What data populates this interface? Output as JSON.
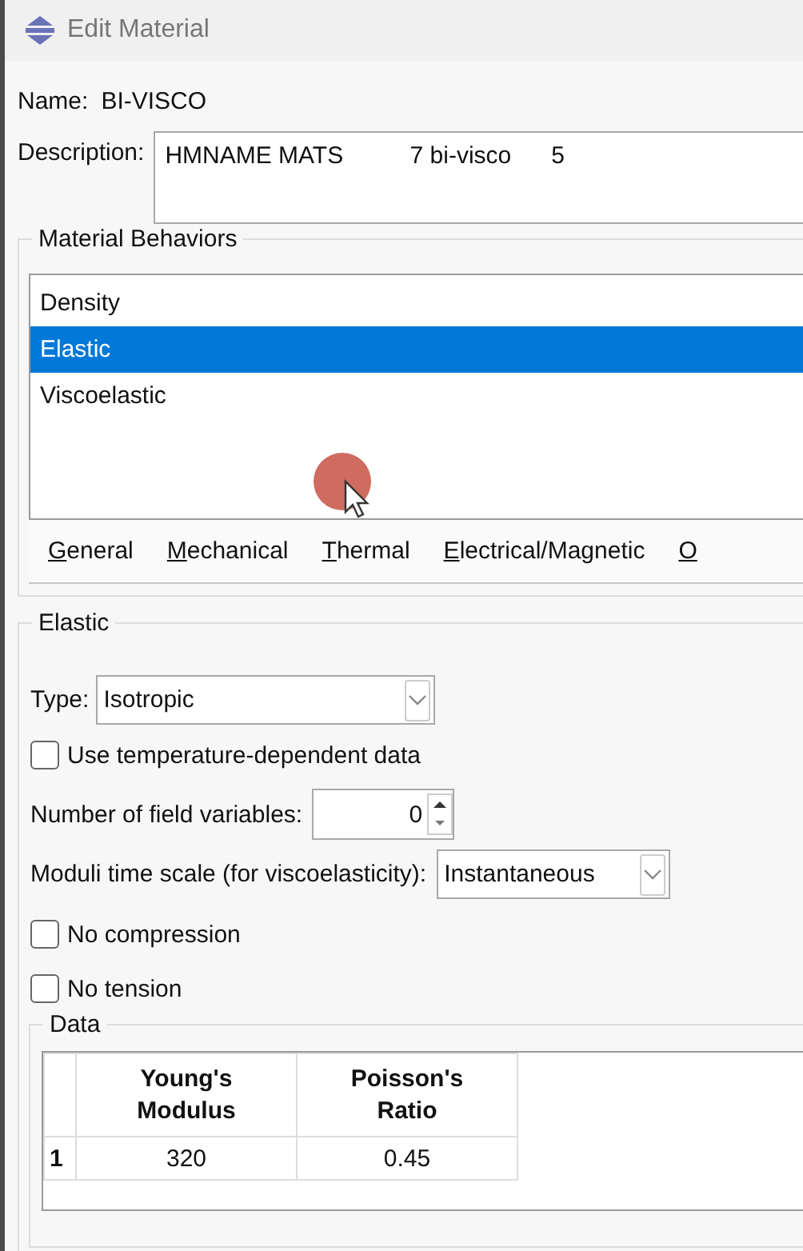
{
  "window": {
    "title": "Edit Material"
  },
  "name": {
    "label": "Name:",
    "value": "BI-VISCO"
  },
  "description": {
    "label": "Description:",
    "value": "HMNAME MATS          7 bi-visco      5"
  },
  "behaviors": {
    "title": "Material Behaviors",
    "items": [
      {
        "label": "Density",
        "selected": false
      },
      {
        "label": "Elastic",
        "selected": true
      },
      {
        "label": "Viscoelastic",
        "selected": false
      }
    ],
    "menu": [
      "General",
      "Mechanical",
      "Thermal",
      "Electrical/Magnetic",
      "O"
    ]
  },
  "elastic": {
    "title": "Elastic",
    "type": {
      "label": "Type:",
      "value": "Isotropic"
    },
    "temperature": {
      "label": "Use temperature-dependent data",
      "checked": false
    },
    "field_variables": {
      "label": "Number of field variables:",
      "value": "0"
    },
    "moduli": {
      "label": "Moduli time scale (for viscoelasticity):",
      "value": "Instantaneous"
    },
    "options": [
      {
        "label": "No compression",
        "checked": false
      },
      {
        "label": "No tension",
        "checked": false
      }
    ],
    "data": {
      "title": "Data",
      "columns": [
        "Young's Modulus",
        "Poisson's Ratio"
      ],
      "rows": [
        {
          "index": "1",
          "cells": [
            "320",
            "0.45"
          ]
        }
      ]
    }
  }
}
